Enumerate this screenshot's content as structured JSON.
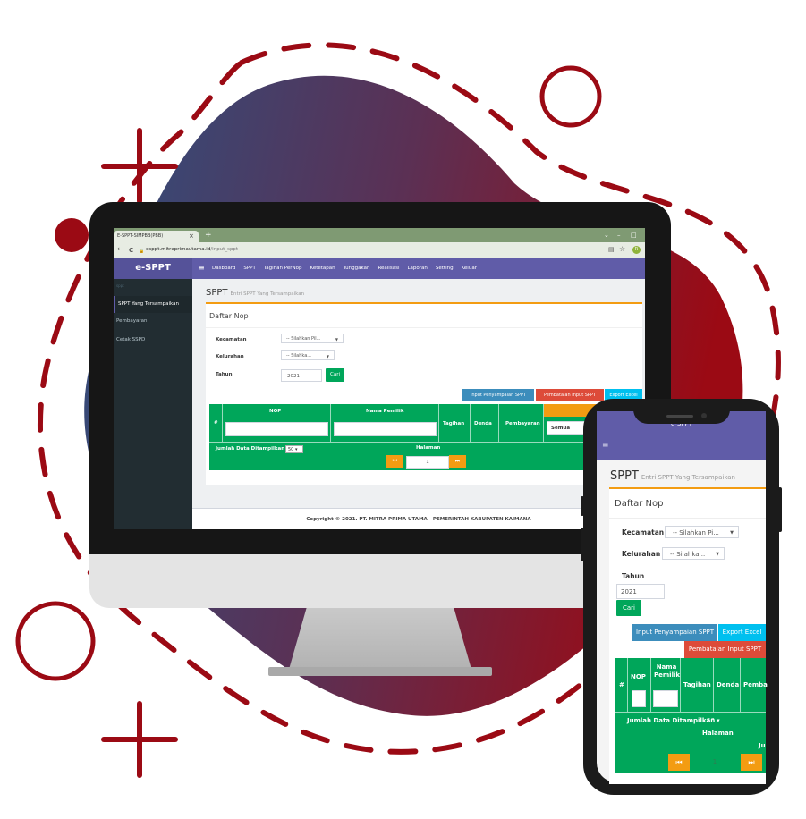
{
  "colors": {
    "accent_red": "#9b0a14",
    "brand_purple": "#605ca8",
    "green": "#00a65a",
    "orange": "#f39c12",
    "blue": "#3c8dbc",
    "red": "#dd4b39",
    "aqua": "#00c0ef",
    "sidebar": "#222d32"
  },
  "browser": {
    "tab_title": "E-SPPT-SIMPBB(PBB)",
    "tab_close": "×",
    "tab_new": "+",
    "url": "esppt.mitraprimautama.id/input_sppt",
    "url_domain": "esppt.mitraprimautama.id",
    "url_path": "/input_sppt",
    "back_icon": "←",
    "reload_icon": "C",
    "lock_icon": "🔒",
    "profile": "R",
    "window_controls": [
      "⌄",
      "–",
      "□"
    ]
  },
  "app": {
    "brand": "e-SPPT",
    "menu_icon": "≡",
    "nav": [
      "Dasboard",
      "SPPT",
      "Tagihan PerNop",
      "Ketetapan",
      "Tunggakan",
      "Realisasi",
      "Laporan",
      "Setting",
      "Keluar"
    ],
    "sidebar_header": "sppt",
    "sidebar": [
      "SPPT Yang Tersampaikan",
      "Pembayaran",
      "Cetak SSPD"
    ],
    "page_title": "SPPT",
    "page_subtitle": "Entri SPPT Yang Tersampaikan",
    "box_title": "Daftar Nop",
    "form": {
      "kecamatan_label": "Kecamatan",
      "kecamatan_value": "-- Silahkan Pil...",
      "kelurahan_label": "Kelurahan",
      "kelurahan_value": "-- Silahka...",
      "tahun_label": "Tahun",
      "tahun_value": "2021",
      "cari_label": "Cari"
    },
    "actions": {
      "input": "Input Penyampaian SPPT",
      "batal": "Pembatalan Input SPPT",
      "export": "Export Excel"
    },
    "table": {
      "headers": [
        "#",
        "NOP",
        "Nama Pemilik",
        "Tagihan",
        "Denda",
        "Pembayaran"
      ],
      "filter_value": "Semua",
      "jumlah_label": "Jumlah Data Ditampilkan",
      "jumlah_value": "50",
      "halaman_label": "Halaman",
      "page_value": "1",
      "prev_icon": "⏮",
      "next_icon": "⏭"
    },
    "footer": "Copyright © 2021. PT. MITRA PRIMA UTAMA - PEMERINTAH KABUPATEN KAIMANA"
  },
  "mobile": {
    "status_text": "e-SPPT",
    "menu_icon": "≡",
    "page_title": "SPPT",
    "page_subtitle": "Entri SPPT Yang Tersampaikan",
    "box_title": "Daftar Nop",
    "kecamatan_label": "Kecamatan",
    "kecamatan_value": "-- Silahkan Pi...",
    "kelurahan_label": "Kelurahan",
    "kelurahan_value": "-- Silahka...",
    "tahun_label": "Tahun",
    "tahun_value": "2021",
    "cari_label": "Cari",
    "btn_input": "Input Penyampaian SPPT",
    "btn_export": "Export Excel",
    "btn_batal": "Pembatalan Input SPPT",
    "headers": [
      "#",
      "NOP",
      "Nama Pemilik",
      "Tagihan",
      "Denda",
      "Pemba"
    ],
    "jumlah_label": "Jumlah Data Ditampilkan",
    "jumlah_value": "50",
    "halaman_label": "Halaman",
    "partial_label": "Ju",
    "page_value": "1",
    "prev_icon": "⏮",
    "next_icon": "⏭"
  }
}
